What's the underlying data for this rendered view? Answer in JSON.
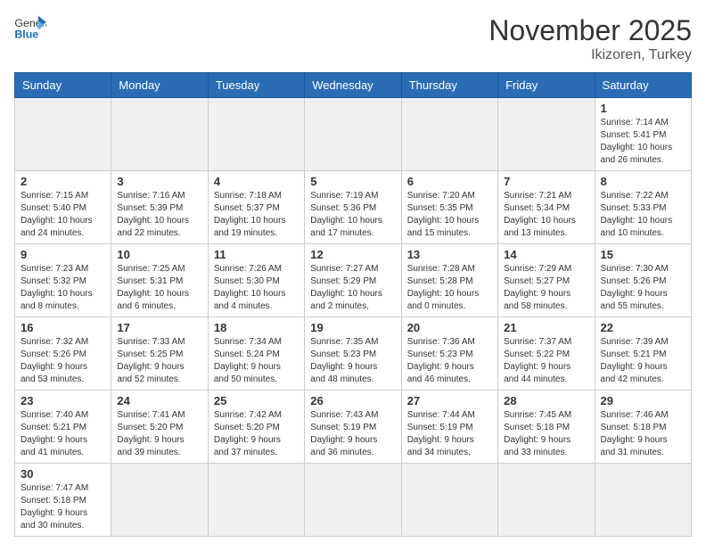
{
  "header": {
    "logo_general": "General",
    "logo_blue": "Blue",
    "month": "November 2025",
    "location": "Ikizoren, Turkey"
  },
  "days_of_week": [
    "Sunday",
    "Monday",
    "Tuesday",
    "Wednesday",
    "Thursday",
    "Friday",
    "Saturday"
  ],
  "weeks": [
    [
      {
        "day": "",
        "info": ""
      },
      {
        "day": "",
        "info": ""
      },
      {
        "day": "",
        "info": ""
      },
      {
        "day": "",
        "info": ""
      },
      {
        "day": "",
        "info": ""
      },
      {
        "day": "",
        "info": ""
      },
      {
        "day": "1",
        "info": "Sunrise: 7:14 AM\nSunset: 5:41 PM\nDaylight: 10 hours\nand 26 minutes."
      }
    ],
    [
      {
        "day": "2",
        "info": "Sunrise: 7:15 AM\nSunset: 5:40 PM\nDaylight: 10 hours\nand 24 minutes."
      },
      {
        "day": "3",
        "info": "Sunrise: 7:16 AM\nSunset: 5:39 PM\nDaylight: 10 hours\nand 22 minutes."
      },
      {
        "day": "4",
        "info": "Sunrise: 7:18 AM\nSunset: 5:37 PM\nDaylight: 10 hours\nand 19 minutes."
      },
      {
        "day": "5",
        "info": "Sunrise: 7:19 AM\nSunset: 5:36 PM\nDaylight: 10 hours\nand 17 minutes."
      },
      {
        "day": "6",
        "info": "Sunrise: 7:20 AM\nSunset: 5:35 PM\nDaylight: 10 hours\nand 15 minutes."
      },
      {
        "day": "7",
        "info": "Sunrise: 7:21 AM\nSunset: 5:34 PM\nDaylight: 10 hours\nand 13 minutes."
      },
      {
        "day": "8",
        "info": "Sunrise: 7:22 AM\nSunset: 5:33 PM\nDaylight: 10 hours\nand 10 minutes."
      }
    ],
    [
      {
        "day": "9",
        "info": "Sunrise: 7:23 AM\nSunset: 5:32 PM\nDaylight: 10 hours\nand 8 minutes."
      },
      {
        "day": "10",
        "info": "Sunrise: 7:25 AM\nSunset: 5:31 PM\nDaylight: 10 hours\nand 6 minutes."
      },
      {
        "day": "11",
        "info": "Sunrise: 7:26 AM\nSunset: 5:30 PM\nDaylight: 10 hours\nand 4 minutes."
      },
      {
        "day": "12",
        "info": "Sunrise: 7:27 AM\nSunset: 5:29 PM\nDaylight: 10 hours\nand 2 minutes."
      },
      {
        "day": "13",
        "info": "Sunrise: 7:28 AM\nSunset: 5:28 PM\nDaylight: 10 hours\nand 0 minutes."
      },
      {
        "day": "14",
        "info": "Sunrise: 7:29 AM\nSunset: 5:27 PM\nDaylight: 9 hours\nand 58 minutes."
      },
      {
        "day": "15",
        "info": "Sunrise: 7:30 AM\nSunset: 5:26 PM\nDaylight: 9 hours\nand 55 minutes."
      }
    ],
    [
      {
        "day": "16",
        "info": "Sunrise: 7:32 AM\nSunset: 5:26 PM\nDaylight: 9 hours\nand 53 minutes."
      },
      {
        "day": "17",
        "info": "Sunrise: 7:33 AM\nSunset: 5:25 PM\nDaylight: 9 hours\nand 52 minutes."
      },
      {
        "day": "18",
        "info": "Sunrise: 7:34 AM\nSunset: 5:24 PM\nDaylight: 9 hours\nand 50 minutes."
      },
      {
        "day": "19",
        "info": "Sunrise: 7:35 AM\nSunset: 5:23 PM\nDaylight: 9 hours\nand 48 minutes."
      },
      {
        "day": "20",
        "info": "Sunrise: 7:36 AM\nSunset: 5:23 PM\nDaylight: 9 hours\nand 46 minutes."
      },
      {
        "day": "21",
        "info": "Sunrise: 7:37 AM\nSunset: 5:22 PM\nDaylight: 9 hours\nand 44 minutes."
      },
      {
        "day": "22",
        "info": "Sunrise: 7:39 AM\nSunset: 5:21 PM\nDaylight: 9 hours\nand 42 minutes."
      }
    ],
    [
      {
        "day": "23",
        "info": "Sunrise: 7:40 AM\nSunset: 5:21 PM\nDaylight: 9 hours\nand 41 minutes."
      },
      {
        "day": "24",
        "info": "Sunrise: 7:41 AM\nSunset: 5:20 PM\nDaylight: 9 hours\nand 39 minutes."
      },
      {
        "day": "25",
        "info": "Sunrise: 7:42 AM\nSunset: 5:20 PM\nDaylight: 9 hours\nand 37 minutes."
      },
      {
        "day": "26",
        "info": "Sunrise: 7:43 AM\nSunset: 5:19 PM\nDaylight: 9 hours\nand 36 minutes."
      },
      {
        "day": "27",
        "info": "Sunrise: 7:44 AM\nSunset: 5:19 PM\nDaylight: 9 hours\nand 34 minutes."
      },
      {
        "day": "28",
        "info": "Sunrise: 7:45 AM\nSunset: 5:18 PM\nDaylight: 9 hours\nand 33 minutes."
      },
      {
        "day": "29",
        "info": "Sunrise: 7:46 AM\nSunset: 5:18 PM\nDaylight: 9 hours\nand 31 minutes."
      }
    ],
    [
      {
        "day": "30",
        "info": "Sunrise: 7:47 AM\nSunset: 5:18 PM\nDaylight: 9 hours\nand 30 minutes."
      },
      {
        "day": "",
        "info": ""
      },
      {
        "day": "",
        "info": ""
      },
      {
        "day": "",
        "info": ""
      },
      {
        "day": "",
        "info": ""
      },
      {
        "day": "",
        "info": ""
      },
      {
        "day": "",
        "info": ""
      }
    ]
  ]
}
